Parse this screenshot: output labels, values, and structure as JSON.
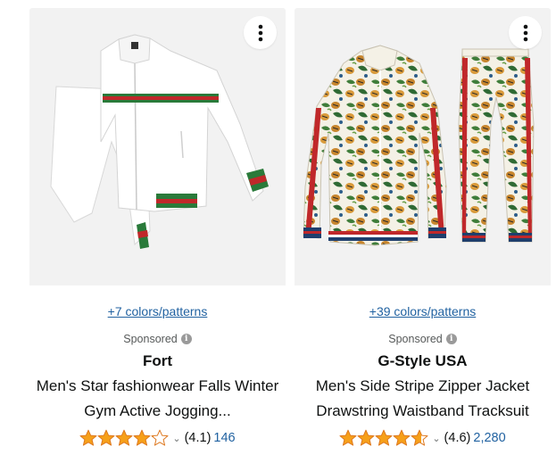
{
  "products": [
    {
      "colors_link": "+7 colors/patterns",
      "sponsored": "Sponsored",
      "brand": "Fort",
      "title": "Men's Star fashionwear Falls Winter Gym Active Jogging...",
      "rating_value": 4.1,
      "rating_text": "(4.1)",
      "review_count": "146",
      "image_icon": "white-tracksuit-image"
    },
    {
      "colors_link": "+39 colors/patterns",
      "sponsored": "Sponsored",
      "brand": "G-Style USA",
      "title": "Men's Side Stripe Zipper Jacket Drawstring Waistband Tracksuit",
      "rating_value": 4.6,
      "rating_text": "(4.6)",
      "review_count": "2,280",
      "image_icon": "tiger-print-tracksuit-image"
    }
  ],
  "colors": {
    "star_fill": "#f6a01a",
    "link": "#2162a1"
  }
}
